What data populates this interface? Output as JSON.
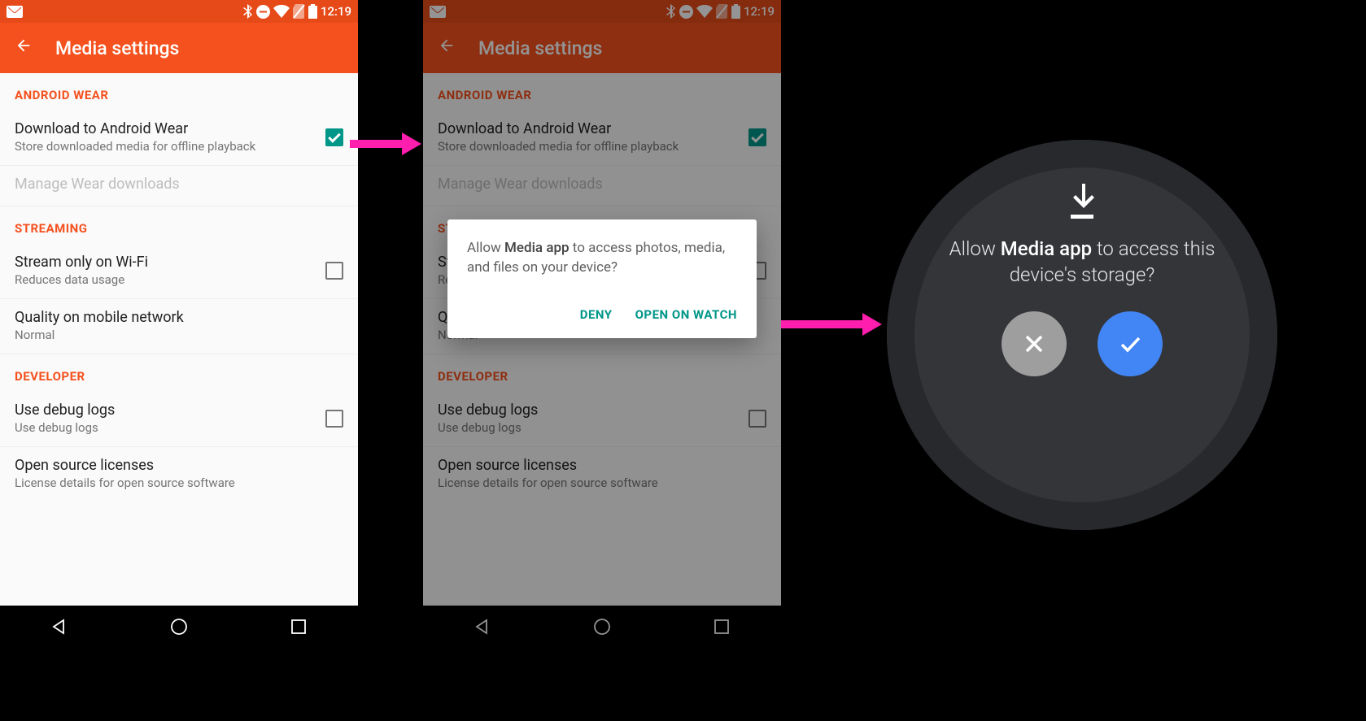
{
  "status": {
    "time": "12:19"
  },
  "appbar": {
    "title": "Media settings"
  },
  "sections": {
    "wear": {
      "header": "ANDROID WEAR",
      "download": {
        "title": "Download to Android Wear",
        "sub": "Store downloaded media for offline playback",
        "checked": true
      },
      "manage": {
        "title": "Manage Wear downloads"
      }
    },
    "streaming": {
      "header": "STREAMING",
      "wifi": {
        "title": "Stream only on Wi-Fi",
        "sub": "Reduces data usage",
        "checked": false
      },
      "quality": {
        "title": "Quality on mobile network",
        "sub": "Normal"
      }
    },
    "developer": {
      "header": "DEVELOPER",
      "debug": {
        "title": "Use debug logs",
        "sub": "Use debug logs",
        "checked": false
      },
      "licenses": {
        "title": "Open source licenses",
        "sub": "License details for open source software"
      }
    }
  },
  "dialog": {
    "text_prefix": "Allow ",
    "text_app": "Media app",
    "text_suffix": " to access photos, media, and files on your device?",
    "deny": "DENY",
    "open": "OPEN ON WATCH"
  },
  "watch": {
    "text_prefix": "Allow ",
    "text_app": "Media app",
    "text_suffix": "  to access this device's storage?"
  }
}
